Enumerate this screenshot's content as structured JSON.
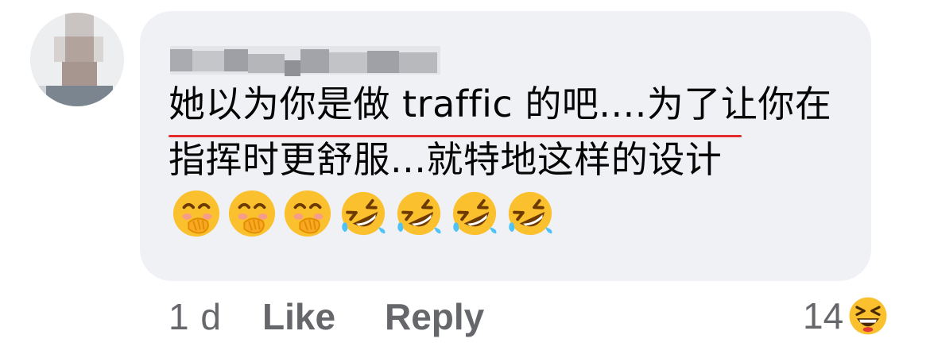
{
  "author": {
    "name_blurred": true
  },
  "comment": {
    "underlined_text": "她以为你是做 traffic 的吧....",
    "rest_text": "为了让你在指挥时更舒服...就特地这样的设计",
    "emojis": [
      "hand-over-mouth-emoji",
      "hand-over-mouth-emoji",
      "hand-over-mouth-emoji",
      "rofl-emoji",
      "rofl-emoji",
      "rofl-emoji",
      "rofl-emoji"
    ]
  },
  "actions": {
    "time": "1 d",
    "like_label": "Like",
    "reply_label": "Reply"
  },
  "reaction": {
    "count": "14",
    "emoji": "grinning-squinting-emoji"
  },
  "colors": {
    "bubble": "#f0f1f5",
    "action_text": "#65676b",
    "underline": "#e32b2b"
  }
}
